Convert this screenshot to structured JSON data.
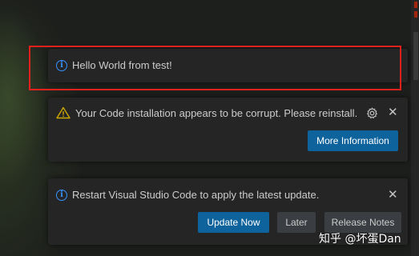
{
  "notifications": [
    {
      "type": "info",
      "icon": "info-icon",
      "message": "Hello World from test!",
      "actions": []
    },
    {
      "type": "warning",
      "icon": "warning-icon",
      "message": "Your Code installation appears to be corrupt. Please reinstall.",
      "actions": [
        "More Information"
      ],
      "controls": [
        "gear-icon",
        "close-icon"
      ]
    },
    {
      "type": "info",
      "icon": "info-icon",
      "message": "Restart Visual Studio Code to apply the latest update.",
      "actions": [
        "Update Now",
        "Later",
        "Release Notes"
      ],
      "controls": [
        "close-icon"
      ]
    }
  ],
  "watermark": "知乎 @坏蛋Dan",
  "colors": {
    "info": "#3794ff",
    "warning": "#cca700",
    "primary_button": "#0e639c",
    "secondary_button": "#3a3d41",
    "toast_bg": "#252526",
    "highlight": "#e6201c"
  }
}
